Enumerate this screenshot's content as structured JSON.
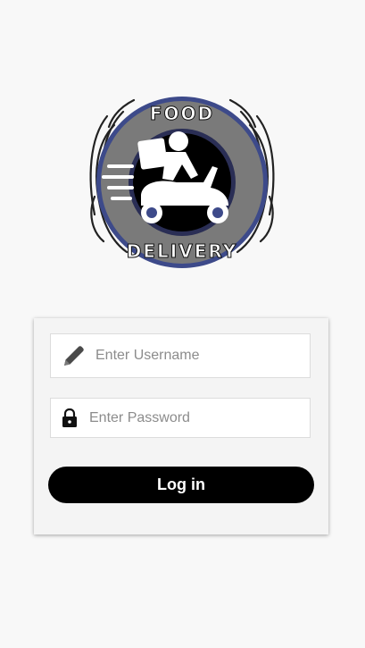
{
  "logo": {
    "line1": "FOOD",
    "line2": "DELIVERY"
  },
  "form": {
    "username_placeholder": "Enter Username",
    "username_icon": "pencil-icon",
    "password_placeholder": "Enter Password",
    "password_icon": "lock-icon",
    "login_label": "Log in"
  },
  "colors": {
    "background": "#f8f8f8",
    "button": "#000000",
    "button_text": "#ffffff",
    "logo_ring": "#3d4a8a",
    "logo_grey": "#7a7a7a"
  }
}
